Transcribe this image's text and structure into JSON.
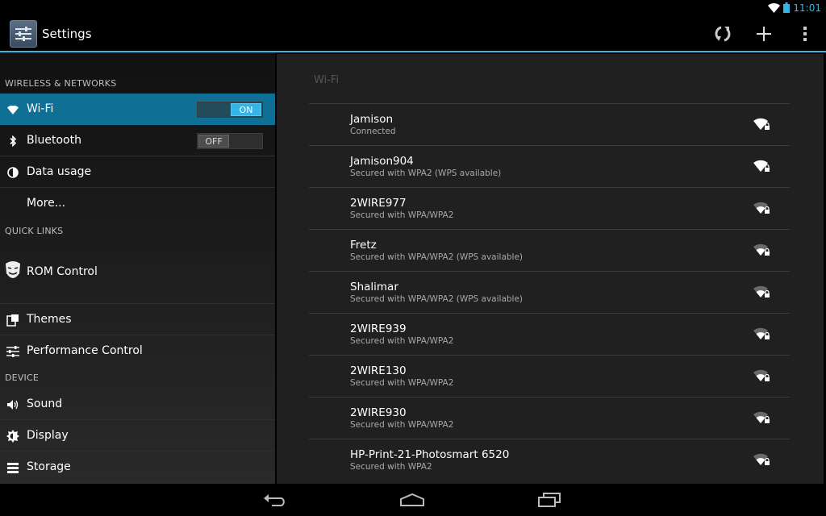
{
  "status_bar": {
    "time": "11:01",
    "icons": [
      "wifi-signal-icon",
      "battery-icon"
    ]
  },
  "action_bar": {
    "title": "Settings",
    "actions": [
      "refresh-wps-icon",
      "add-network-icon",
      "overflow-menu-icon"
    ]
  },
  "colors": {
    "accent": "#33b5e5",
    "selected_item": "#0f6f94",
    "pane_bg": "#202020"
  },
  "left_pane": {
    "sections": [
      {
        "header": "WIRELESS & NETWORKS"
      },
      {
        "header": "QUICK LINKS"
      },
      {
        "header": "DEVICE"
      }
    ],
    "items": [
      {
        "label": "Wi-Fi",
        "icon": "wifi-icon",
        "toggle": "ON",
        "selected": true
      },
      {
        "label": "Bluetooth",
        "icon": "bluetooth-icon",
        "toggle": "OFF"
      },
      {
        "label": "Data usage",
        "icon": "data-usage-icon"
      },
      {
        "label": "More..."
      },
      {
        "label": "ROM Control",
        "icon": "mask-icon"
      },
      {
        "label": "Themes",
        "icon": "themes-icon"
      },
      {
        "label": "Performance Control",
        "icon": "sliders-icon"
      },
      {
        "label": "Sound",
        "icon": "speaker-icon"
      },
      {
        "label": "Display",
        "icon": "brightness-icon"
      },
      {
        "label": "Storage",
        "icon": "storage-icon"
      }
    ]
  },
  "wifi": {
    "title": "Wi-Fi",
    "networks": [
      {
        "name": "Jamison",
        "status": "Connected",
        "strength": "full"
      },
      {
        "name": "Jamison904",
        "status": "Secured with WPA2 (WPS available)",
        "strength": "full"
      },
      {
        "name": "2WIRE977",
        "status": "Secured with WPA/WPA2",
        "strength": "weak"
      },
      {
        "name": "Fretz",
        "status": "Secured with WPA/WPA2 (WPS available)",
        "strength": "weak"
      },
      {
        "name": "Shalimar",
        "status": "Secured with WPA/WPA2 (WPS available)",
        "strength": "weak"
      },
      {
        "name": "2WIRE939",
        "status": "Secured with WPA/WPA2",
        "strength": "weak"
      },
      {
        "name": "2WIRE130",
        "status": "Secured with WPA/WPA2",
        "strength": "weak"
      },
      {
        "name": "2WIRE930",
        "status": "Secured with WPA/WPA2",
        "strength": "weak"
      },
      {
        "name": "HP-Print-21-Photosmart 6520",
        "status": "Secured with WPA2",
        "strength": "weak"
      }
    ]
  },
  "nav_bar": {
    "buttons": [
      "back-icon",
      "home-icon",
      "recent-apps-icon"
    ]
  }
}
